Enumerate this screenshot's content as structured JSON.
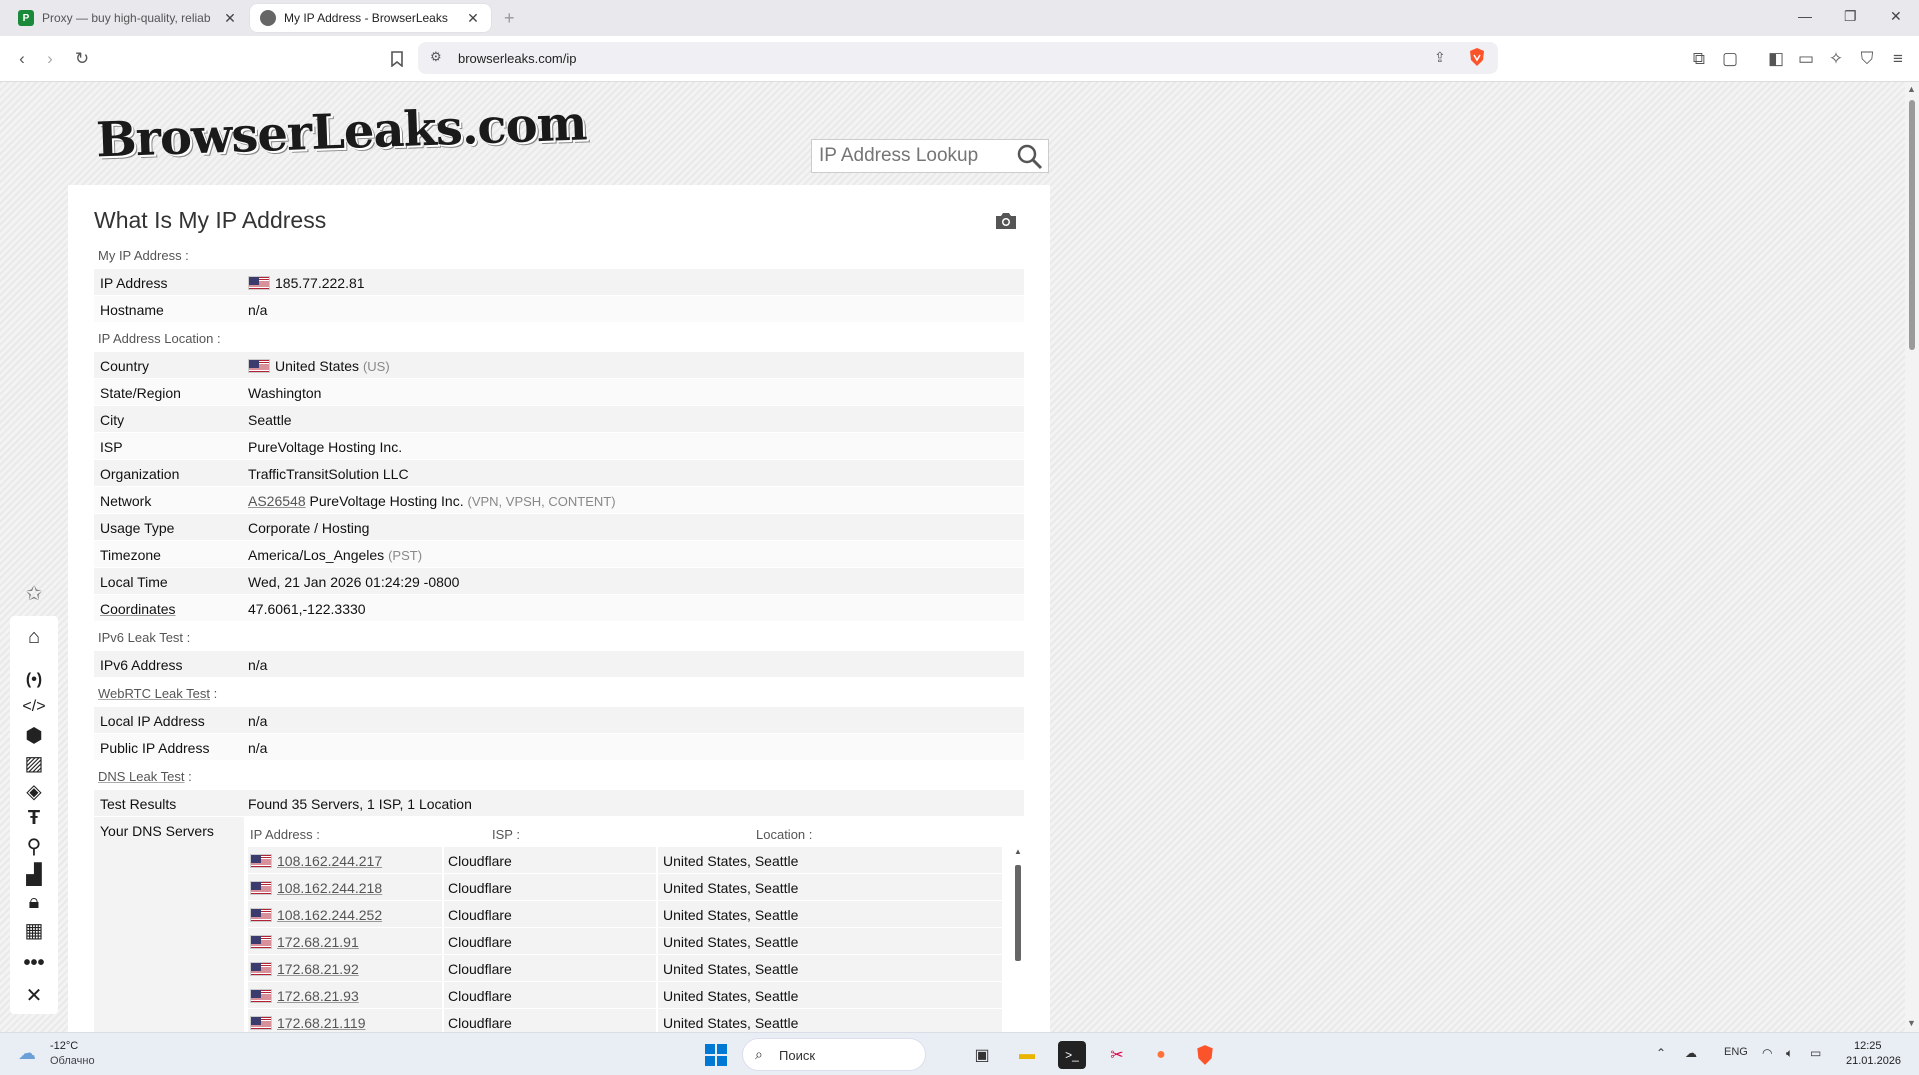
{
  "browser": {
    "tabs": [
      {
        "title": "Proxy — buy high-quality, reliab",
        "active": false,
        "favicon": "proxy-favicon"
      },
      {
        "title": "My IP Address - BrowserLeaks",
        "active": true,
        "favicon": "browserleaks-favicon"
      }
    ],
    "url": "browserleaks.com/ip"
  },
  "site": {
    "logo_text": "BrowserLeaks.com",
    "search_placeholder": "IP Address Lookup"
  },
  "page": {
    "title": "What Is My IP Address",
    "sections": {
      "my_ip": "My IP Address :",
      "location": "IP Address Location :",
      "ipv6": "IPv6 Leak Test :",
      "webrtc": "WebRTC Leak Test",
      "dns": "DNS Leak Test"
    },
    "ip": {
      "ip_label": "IP Address",
      "ip_value": "185.77.222.81",
      "hostname_label": "Hostname",
      "hostname_value": "n/a"
    },
    "location": {
      "country_label": "Country",
      "country_value": "United States",
      "country_code": "(US)",
      "state_label": "State/Region",
      "state_value": "Washington",
      "city_label": "City",
      "city_value": "Seattle",
      "isp_label": "ISP",
      "isp_value": "PureVoltage Hosting Inc.",
      "org_label": "Organization",
      "org_value": "TrafficTransitSolution LLC",
      "network_label": "Network",
      "network_asn": "AS26548",
      "network_name": "PureVoltage Hosting Inc.",
      "network_tags": "(VPN, VPSH, CONTENT)",
      "usage_label": "Usage Type",
      "usage_value": "Corporate / Hosting",
      "tz_label": "Timezone",
      "tz_value": "America/Los_Angeles",
      "tz_abbr": "(PST)",
      "time_label": "Local Time",
      "time_value": "Wed, 21 Jan 2026 01:24:29 -0800",
      "coords_label": "Coordinates",
      "coords_value": "47.6061,-122.3330"
    },
    "ipv6": {
      "label": "IPv6 Address",
      "value": "n/a"
    },
    "webrtc": {
      "local_label": "Local IP Address",
      "local_value": "n/a",
      "public_label": "Public IP Address",
      "public_value": "n/a"
    },
    "dns": {
      "results_label": "Test Results",
      "results_value": "Found 35 Servers, 1 ISP, 1 Location",
      "servers_label": "Your DNS Servers",
      "col_ip": "IP Address :",
      "col_isp": "ISP :",
      "col_loc": "Location :",
      "rows": [
        {
          "ip": "108.162.244.217",
          "isp": "Cloudflare",
          "loc": "United States, Seattle"
        },
        {
          "ip": "108.162.244.218",
          "isp": "Cloudflare",
          "loc": "United States, Seattle"
        },
        {
          "ip": "108.162.244.252",
          "isp": "Cloudflare",
          "loc": "United States, Seattle"
        },
        {
          "ip": "172.68.21.91",
          "isp": "Cloudflare",
          "loc": "United States, Seattle"
        },
        {
          "ip": "172.68.21.92",
          "isp": "Cloudflare",
          "loc": "United States, Seattle"
        },
        {
          "ip": "172.68.21.93",
          "isp": "Cloudflare",
          "loc": "United States, Seattle"
        },
        {
          "ip": "172.68.21.119",
          "isp": "Cloudflare",
          "loc": "United States, Seattle"
        }
      ]
    }
  },
  "taskbar": {
    "weather_temp": "-12°C",
    "weather_desc": "Облачно",
    "search_label": "Поиск",
    "lang": "ENG",
    "time": "12:25",
    "date": "21.01.2026"
  },
  "colors": {
    "brave_orange": "#fb542b",
    "accent_blue": "#0078d4"
  }
}
